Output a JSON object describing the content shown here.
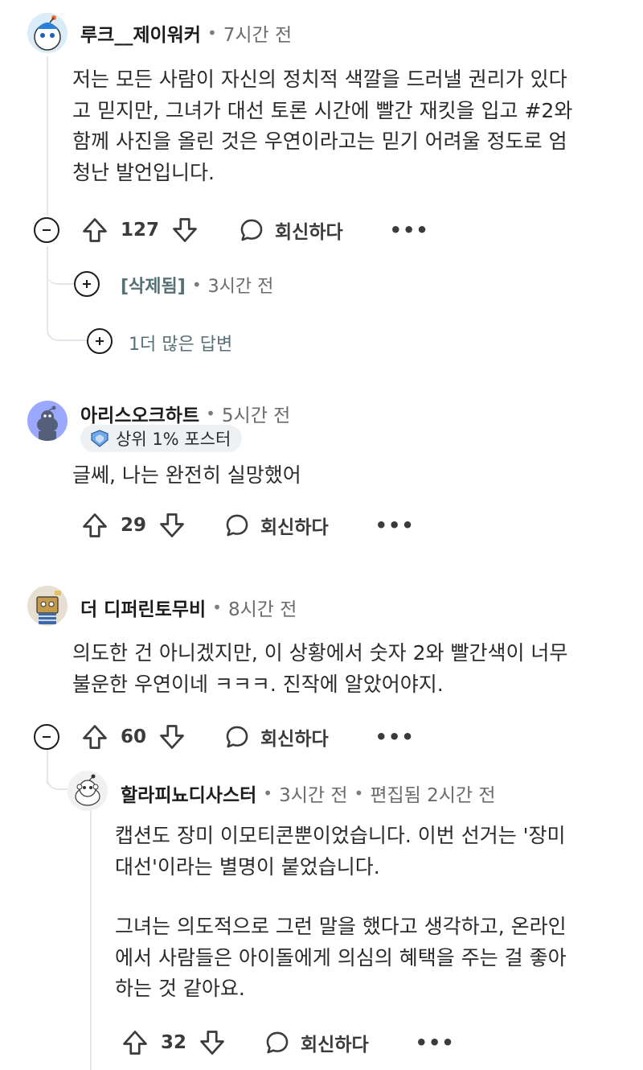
{
  "comments": [
    {
      "username": "루크__제이워커",
      "time": "7시간 전",
      "text": [
        "저는 모든 사람이 자신의 정치적 색깔을 드러낼 권리가 있다",
        "고 믿지만, 그녀가 대선 토론 시간에 빨간 재킷을 입고 #2와",
        "함께 사진을 올린 것은 우연이라고는 믿기 어려울 정도로 엄",
        "청난 발언입니다."
      ],
      "votes": "127",
      "reply_label": "회신하다",
      "more_label": "•••"
    },
    {
      "username": "[삭제됨]",
      "time": "3시간 전",
      "collapsed": true
    },
    {
      "more_replies_label": "1더 많은 답변"
    },
    {
      "username": "아리스오크하트",
      "time": "5시간 전",
      "flair": "상위 1% 포스터",
      "text": [
        "글쎄, 나는 완전히 실망했어"
      ],
      "votes": "29",
      "reply_label": "회신하다",
      "more_label": "•••"
    },
    {
      "username": "더 디퍼린토무비",
      "time": "8시간 전",
      "text": [
        "의도한 건 아니겠지만, 이 상황에서 숫자 2와 빨간색이 너무",
        "불운한 우연이네 ㅋㅋㅋ. 진작에 알았어야지."
      ],
      "votes": "60",
      "reply_label": "회신하다",
      "more_label": "•••"
    },
    {
      "username": "할라피뇨디사스터",
      "time": "3시간 전",
      "edited": "편집됨 2시간 전",
      "paragraphs": [
        [
          "캡션도 장미 이모티콘뿐이었습니다. 이번 선거는 '장미",
          "대선'이라는 별명이 붙었습니다."
        ],
        [
          "그녀는 의도적으로 그런 말을 했다고 생각하고, 온라인",
          "에서 사람들은 아이돌에게 의심의 혜택을 주는 걸 좋아",
          "하는 것 같아요."
        ]
      ],
      "votes": "32",
      "reply_label": "회신하다",
      "more_label": "•••"
    }
  ],
  "colors": {
    "thread_line": "#e2e6ea",
    "text": "#2a2a2a",
    "meta": "#6b6b6b",
    "deleted": "#576f76",
    "badge_bg": "#eef1f3"
  },
  "icons": [
    "upvote-icon",
    "downvote-icon",
    "reply-bubble-icon",
    "collapse-icon",
    "expand-icon",
    "top-poster-icon"
  ]
}
